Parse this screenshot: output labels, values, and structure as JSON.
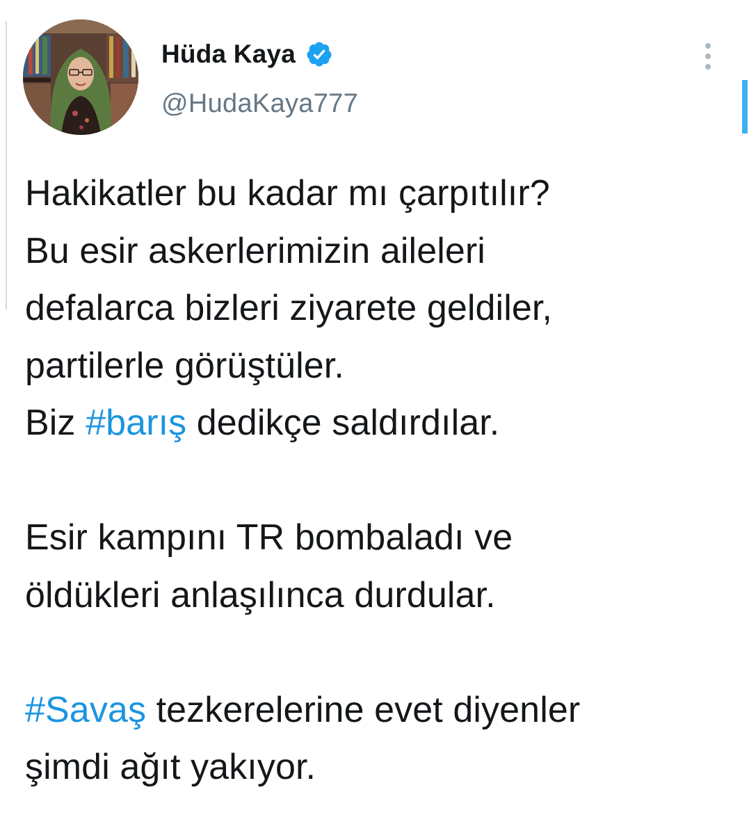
{
  "author": {
    "display_name": "Hüda Kaya",
    "handle": "@HudaKaya777",
    "verified": true,
    "avatar_icon": "profile-photo"
  },
  "icons": {
    "verified": "verified-badge-icon",
    "more": "more-vertical-icon"
  },
  "colors": {
    "hashtag": "#1b95e0",
    "verified_badge": "#1da1f2",
    "handle": "#657786",
    "text": "#14171a"
  },
  "tweet": {
    "lines": [
      {
        "text": "Hakikatler bu kadar mı çarpıtılır?"
      },
      {
        "text": "Bu esir askerlerimizin aileleri"
      },
      {
        "text": "defalarca bizleri ziyarete geldiler,"
      },
      {
        "text": "partilerle görüştüler."
      },
      {
        "pre": "Biz ",
        "hashtag": "#barış",
        "post": " dedikçe saldırdılar."
      },
      {
        "text": "Esir kampını TR bombaladı ve"
      },
      {
        "text": "öldükleri anlaşılınca durdular."
      },
      {
        "pre": "",
        "hashtag": "#Savaş",
        "post": " tezkerelerine evet diyenler"
      },
      {
        "text": "şimdi ağıt yakıyor."
      }
    ]
  }
}
